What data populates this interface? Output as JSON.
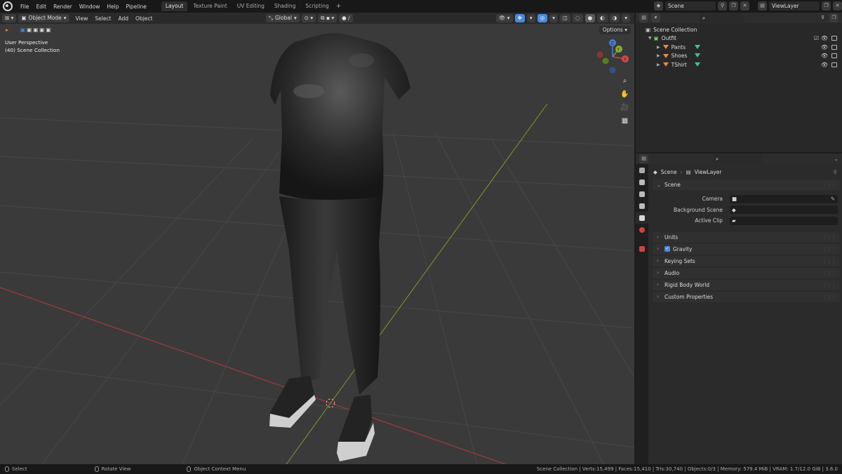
{
  "topbar": {
    "menus": [
      "File",
      "Edit",
      "Render",
      "Window",
      "Help",
      "Pipeline"
    ],
    "workspaces": [
      "Layout",
      "Texture Paint",
      "UV Editing",
      "Shading",
      "Scripting"
    ],
    "active_workspace": "Layout",
    "add_workspace": "+",
    "scene": "Scene",
    "view_layer": "ViewLayer"
  },
  "viewport": {
    "mode": "Object Mode",
    "menus": [
      "View",
      "Select",
      "Add",
      "Object"
    ],
    "transform_orientation": "Global",
    "options": "Options",
    "overlay_line1": "User Perspective",
    "overlay_line2": "(40) Scene Collection",
    "gizmo_labels": {
      "x": "X",
      "y": "Y",
      "z": "Z"
    }
  },
  "outliner": {
    "root": "Scene Collection",
    "collection": "Outfit",
    "objects": [
      "Pants",
      "Shoes",
      "TShirt"
    ]
  },
  "properties": {
    "breadcrumb_scene": "Scene",
    "breadcrumb_sep": "›",
    "breadcrumb_layer": "ViewLayer",
    "panel_scene": "Scene",
    "fields": [
      {
        "label": "Camera",
        "value": ""
      },
      {
        "label": "Background Scene",
        "value": ""
      },
      {
        "label": "Active Clip",
        "value": ""
      }
    ],
    "panels": [
      "Units",
      "Gravity",
      "Keying Sets",
      "Audio",
      "Rigid Body World",
      "Custom Properties"
    ],
    "gravity_checked": true
  },
  "statusbar": {
    "select": "Select",
    "rotate": "Rotate View",
    "context": "Object Context Menu",
    "stats": "Scene Collection | Verts:15,499 | Faces:15,410 | Tris:30,740 | Objects:0/3 | Memory: 579.4 MiB | VRAM: 1.7/12.0 GiB | 3.6.0"
  },
  "colors": {
    "accent": "#4a8ade",
    "axis_x": "#b33a3a",
    "axis_y": "#7a9a2e",
    "viewport_bg": "#3a3a3a"
  }
}
